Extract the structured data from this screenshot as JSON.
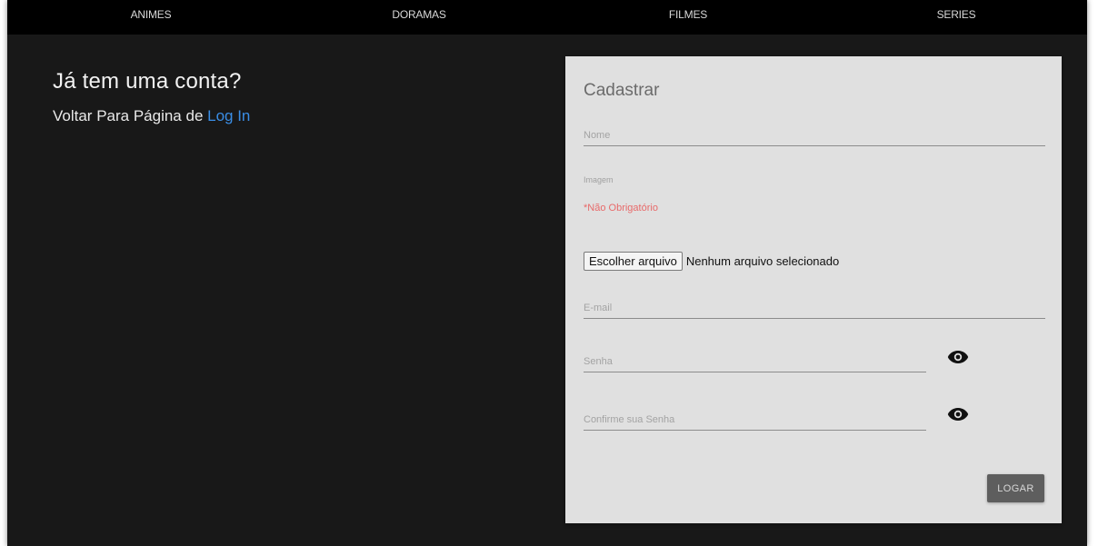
{
  "nav": {
    "items": [
      {
        "id": "animes",
        "label": "ANIMES"
      },
      {
        "id": "doramas",
        "label": "DORAMAS"
      },
      {
        "id": "filmes",
        "label": "FILMES"
      },
      {
        "id": "series",
        "label": "SERIES"
      }
    ]
  },
  "aside": {
    "heading": "Já tem uma conta?",
    "text_prefix": "Voltar Para Página de ",
    "link_label": "Log In"
  },
  "form": {
    "title": "Cadastrar",
    "name_placeholder": "Nome",
    "image_label": "Imagem",
    "image_note": "*Não Obrigatório",
    "file_button": "Escolher arquivo",
    "file_status": "Nenhum arquivo selecionado",
    "email_placeholder": "E-mail",
    "password_placeholder": "Senha",
    "confirm_placeholder": "Confirme sua Senha",
    "submit_label": "LOGAR"
  },
  "icons": {
    "password_toggle": "eye-icon",
    "confirm_toggle": "eye-icon"
  },
  "colors": {
    "page_background": "#181818",
    "navbar": "#000000",
    "card": "#e0e0e0",
    "link": "#3a8ee6",
    "required_note": "#e86a6a",
    "submit_button": "#5e5e5e"
  }
}
